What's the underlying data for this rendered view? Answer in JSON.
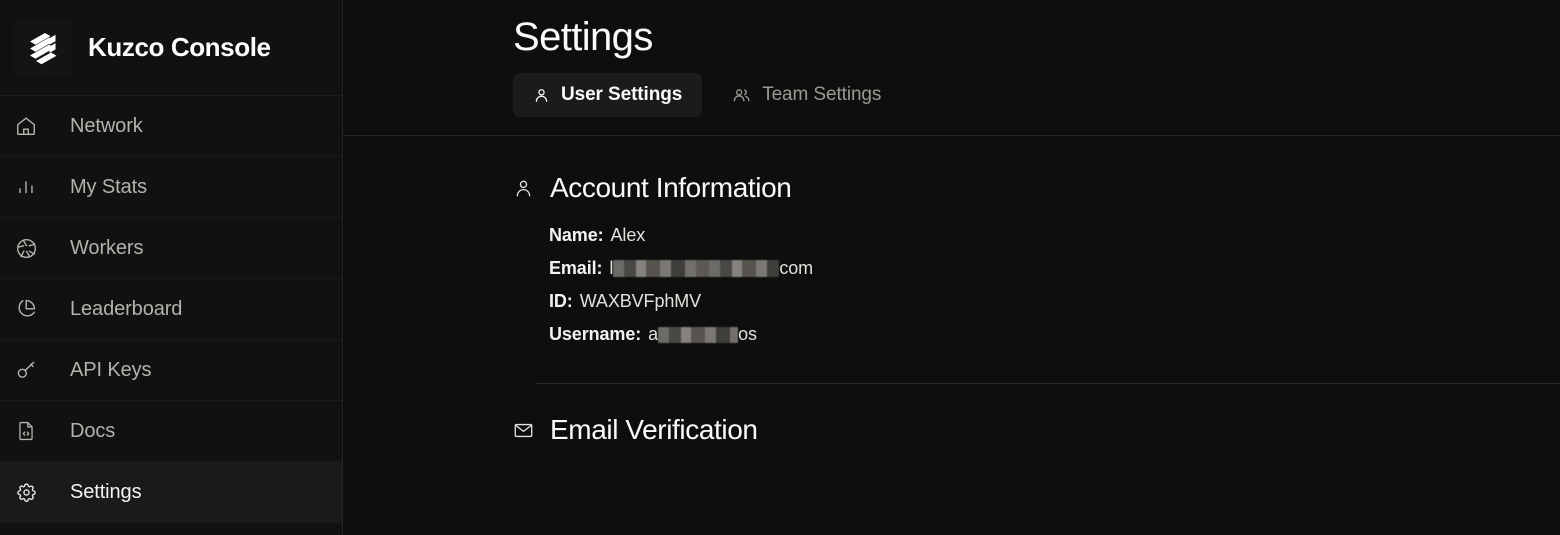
{
  "brand": {
    "title": "Kuzco Console",
    "logo_icon": "layers-logo-icon"
  },
  "sidebar": {
    "items": [
      {
        "label": "Network",
        "icon": "home-icon",
        "active": false
      },
      {
        "label": "My Stats",
        "icon": "bar-chart-icon",
        "active": false
      },
      {
        "label": "Workers",
        "icon": "aperture-icon",
        "active": false
      },
      {
        "label": "Leaderboard",
        "icon": "pie-chart-icon",
        "active": false
      },
      {
        "label": "API Keys",
        "icon": "key-icon",
        "active": false
      },
      {
        "label": "Docs",
        "icon": "file-code-icon",
        "active": false
      },
      {
        "label": "Settings",
        "icon": "gear-icon",
        "active": true
      }
    ]
  },
  "main": {
    "page_title": "Settings",
    "tabs": [
      {
        "label": "User Settings",
        "icon": "user-icon",
        "active": true
      },
      {
        "label": "Team Settings",
        "icon": "users-icon",
        "active": false
      }
    ],
    "account_section": {
      "icon": "user-icon",
      "title": "Account Information",
      "fields": [
        {
          "label": "Name:",
          "value": "Alex",
          "redacted": "none"
        },
        {
          "label": "Email:",
          "value_prefix": "l",
          "value_suffix": "com",
          "redacted": "middle"
        },
        {
          "label": "ID:",
          "value": "WAXBVFphMV",
          "redacted": "none"
        },
        {
          "label": "Username:",
          "value_prefix": "a",
          "value_suffix": "os",
          "redacted": "middle"
        }
      ]
    },
    "email_section": {
      "icon": "mail-icon",
      "title": "Email Verification"
    }
  },
  "colors": {
    "sidebar_bg": "#111111",
    "main_bg": "#0e0e0e",
    "active_item_bg": "#1a1a1a",
    "text_primary": "#fbfaf8",
    "text_muted": "#b5b1ab",
    "divider": "#262626"
  }
}
